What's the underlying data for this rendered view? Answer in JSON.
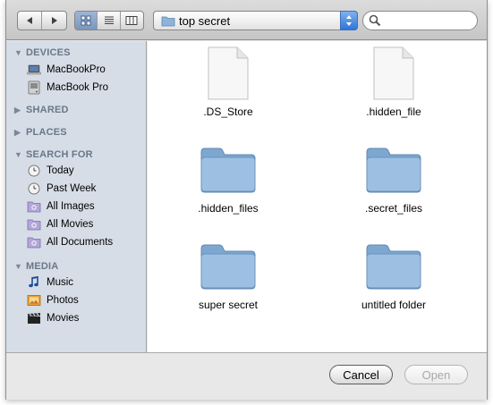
{
  "toolbar": {
    "back_icon": "triangle-left",
    "forward_icon": "triangle-right",
    "view_modes": [
      "icon-view",
      "list-view",
      "column-view"
    ],
    "active_view": "icon-view",
    "location": "top secret",
    "search_placeholder": "",
    "search_value": ""
  },
  "sidebar": {
    "sections": [
      {
        "label": "DEVICES",
        "expanded": true,
        "items": [
          {
            "label": "MacBookPro",
            "icon": "laptop-icon"
          },
          {
            "label": "MacBook Pro",
            "icon": "hard-drive-icon"
          }
        ]
      },
      {
        "label": "SHARED",
        "expanded": false,
        "items": []
      },
      {
        "label": "PLACES",
        "expanded": false,
        "items": []
      },
      {
        "label": "SEARCH FOR",
        "expanded": true,
        "items": [
          {
            "label": "Today",
            "icon": "clock-icon"
          },
          {
            "label": "Past Week",
            "icon": "clock-icon"
          },
          {
            "label": "All Images",
            "icon": "smart-folder-icon"
          },
          {
            "label": "All Movies",
            "icon": "smart-folder-icon"
          },
          {
            "label": "All Documents",
            "icon": "smart-folder-icon"
          }
        ]
      },
      {
        "label": "MEDIA",
        "expanded": true,
        "items": [
          {
            "label": "Music",
            "icon": "music-note-icon"
          },
          {
            "label": "Photos",
            "icon": "photos-icon"
          },
          {
            "label": "Movies",
            "icon": "clapperboard-icon"
          }
        ]
      }
    ]
  },
  "files": [
    {
      "name": ".DS_Store",
      "kind": "document"
    },
    {
      "name": ".hidden_file",
      "kind": "document"
    },
    {
      "name": ".hidden_files",
      "kind": "folder"
    },
    {
      "name": ".secret_files",
      "kind": "folder"
    },
    {
      "name": "super secret",
      "kind": "folder"
    },
    {
      "name": "untitled folder",
      "kind": "folder"
    }
  ],
  "buttons": {
    "cancel": "Cancel",
    "open": "Open"
  },
  "colors": {
    "sidebar_bg": "#d6dde6",
    "section_header": "#68778a",
    "folder_blue": "#8fb4d9",
    "open_disabled": "#a8a8a8"
  }
}
